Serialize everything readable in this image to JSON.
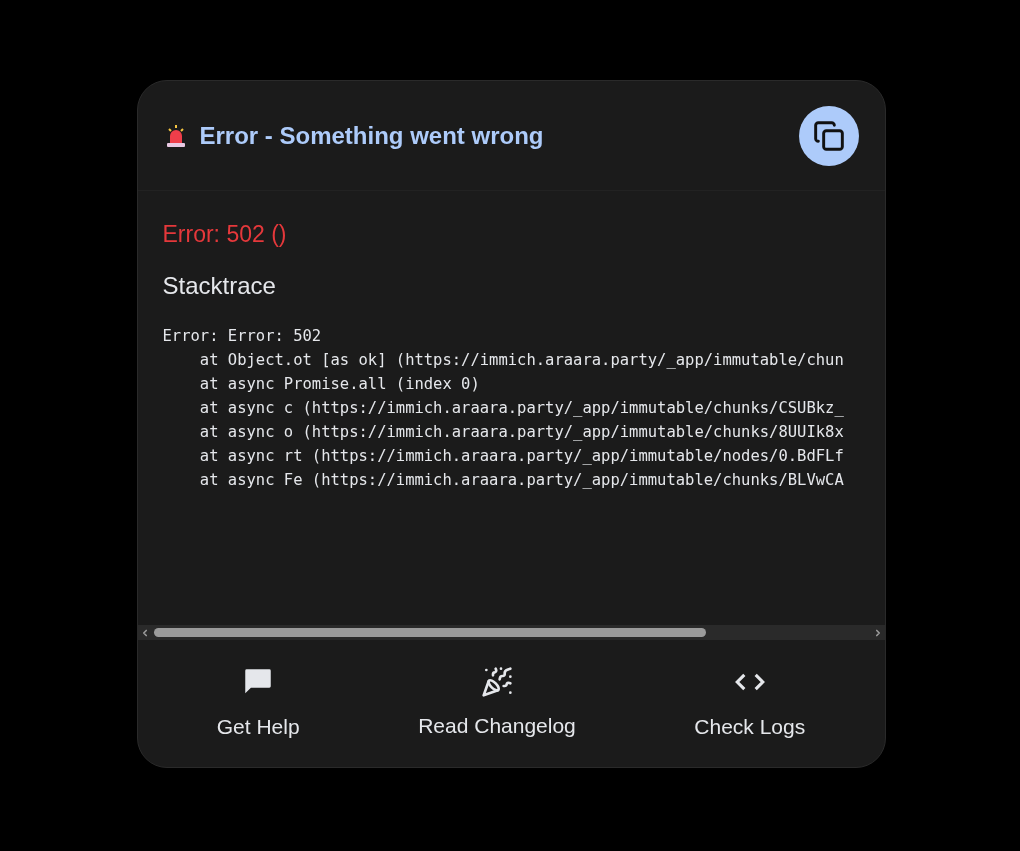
{
  "header": {
    "title": "Error - Something went wrong"
  },
  "error": {
    "message": "Error: 502 ()",
    "stack_heading": "Stacktrace",
    "stack_lines": [
      "Error: Error: 502",
      "    at Object.ot [as ok] (https://immich.araara.party/_app/immutable/chun",
      "    at async Promise.all (index 0)",
      "    at async c (https://immich.araara.party/_app/immutable/chunks/CSUBkz_",
      "    at async o (https://immich.araara.party/_app/immutable/chunks/8UUIk8x",
      "    at async rt (https://immich.araara.party/_app/immutable/nodes/0.BdFLf",
      "    at async Fe (https://immich.araara.party/_app/immutable/chunks/BLVwCA"
    ]
  },
  "actions": [
    {
      "kind": "help",
      "label": "Get Help"
    },
    {
      "kind": "changelog",
      "label": "Read Changelog"
    },
    {
      "kind": "logs",
      "label": "Check Logs"
    }
  ]
}
